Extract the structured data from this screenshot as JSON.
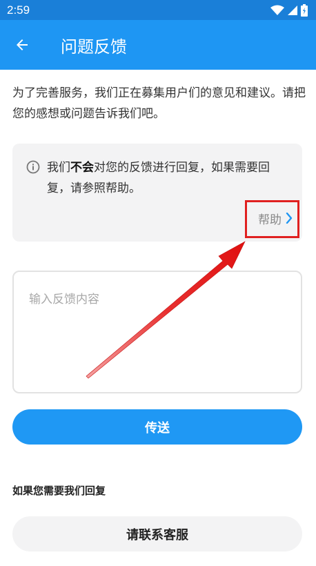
{
  "status_bar": {
    "time": "2:59",
    "icons": [
      "wifi-icon",
      "signal-icon",
      "battery-icon"
    ]
  },
  "app_bar": {
    "title": "问题反馈",
    "back_icon": "arrow-left-icon"
  },
  "intro": {
    "text": "为了完善服务，我们正在募集用户们的意见和建议。请把您的感想或问题告诉我们吧。"
  },
  "info_card": {
    "icon": "info-icon",
    "text_before": "我们",
    "text_bold": "不会",
    "text_after": "对您的反馈进行回复，如果需要回复，请参照帮助。",
    "help_label": "帮助"
  },
  "feedback": {
    "placeholder": "输入反馈内容",
    "value": ""
  },
  "send_button": {
    "label": "传送"
  },
  "reply_section": {
    "label": "如果您需要我们回复",
    "contact_label": "请联系客服"
  },
  "colors": {
    "status_bar": "#1a7fd8",
    "app_bar": "#1e96f3",
    "primary_button": "#1f98f4",
    "annotation": "#e02020"
  }
}
